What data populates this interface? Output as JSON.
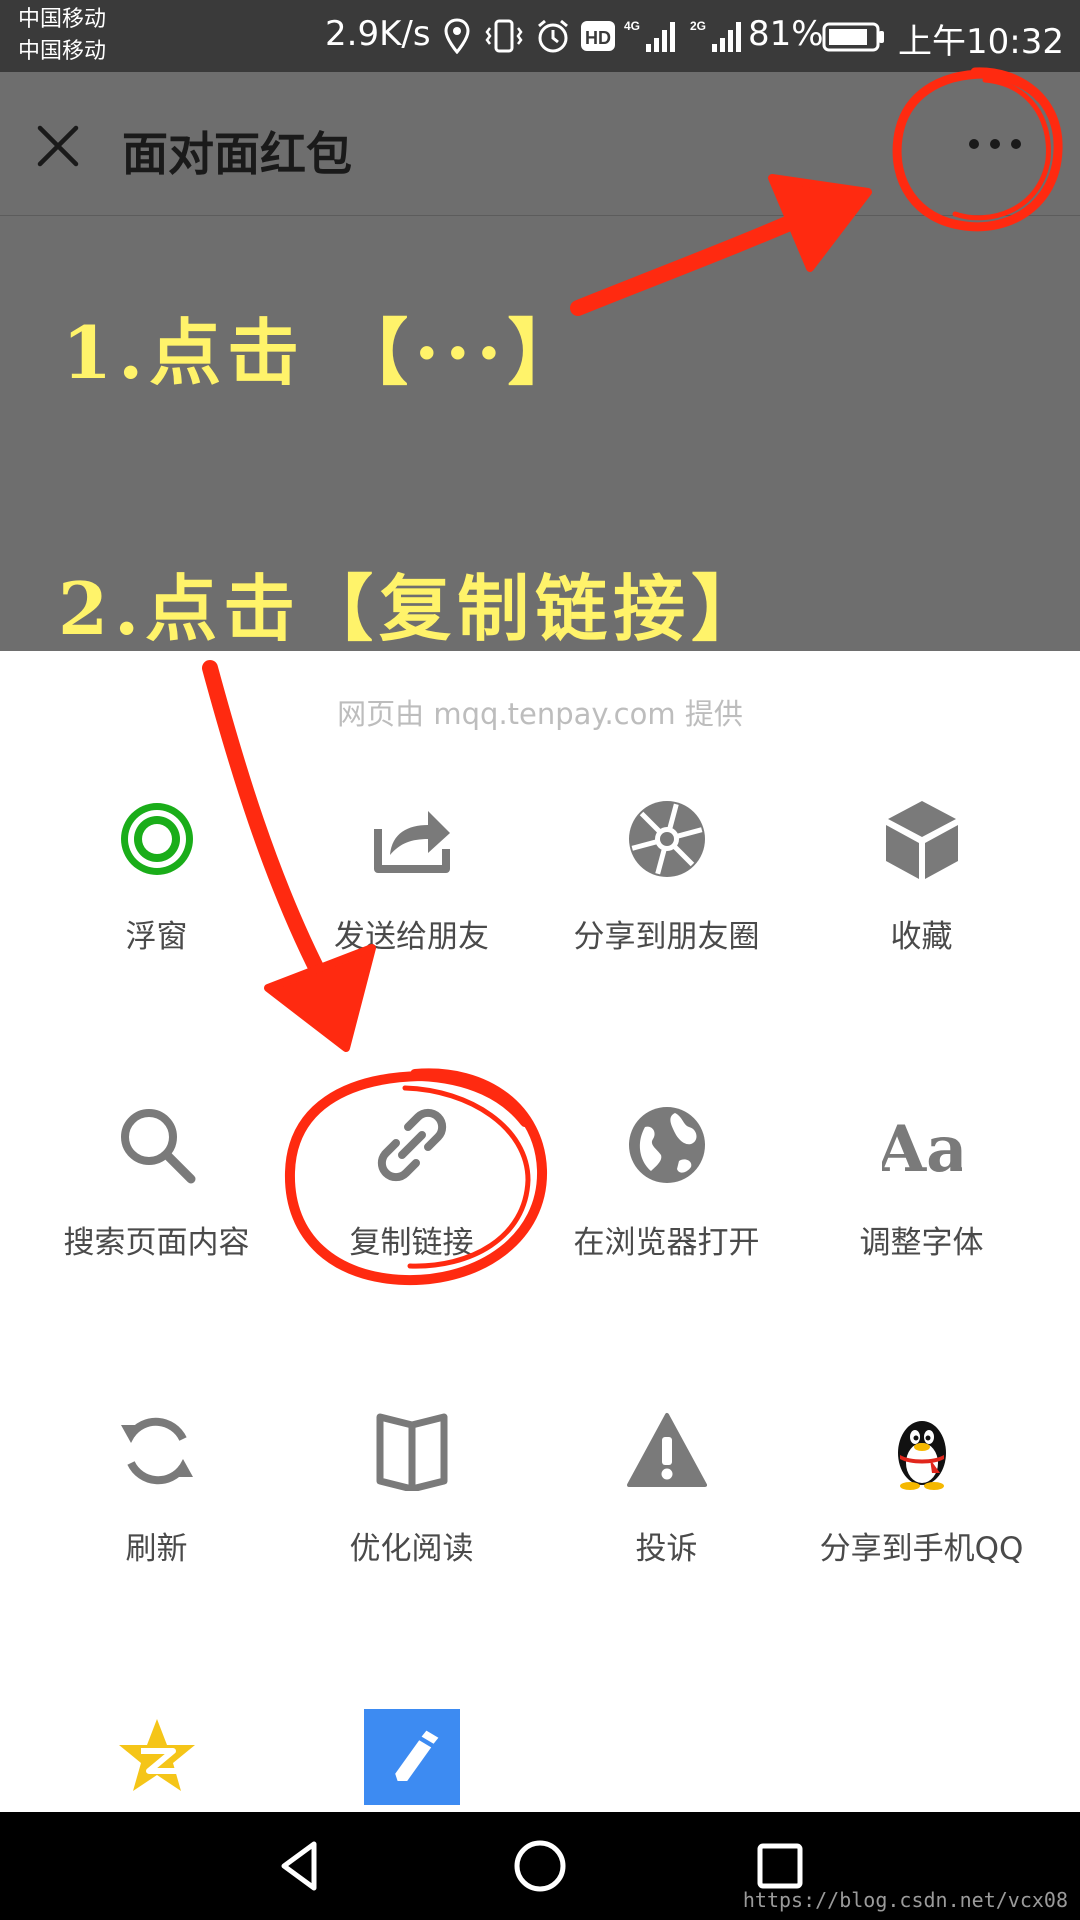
{
  "status_bar": {
    "carrier_1": "中国移动",
    "carrier_2": "中国移动",
    "net_speed": "2.9K/s",
    "signal_label_1": "4G",
    "signal_label_2": "2G",
    "hd_label": "HD",
    "battery_percent": "81%",
    "time": "上午10:32",
    "icons": [
      "location-icon",
      "vibrate-icon",
      "alarm-icon",
      "hd-icon",
      "signal-4g-icon",
      "signal-2g-icon",
      "battery-icon"
    ]
  },
  "header": {
    "close_icon": "close-icon",
    "title": "面对面红包",
    "more_icon": "more-icon"
  },
  "annotations": {
    "step1": "1.点击 【···】",
    "step2": "2.点击【复制链接】",
    "color": "#ff2a10"
  },
  "sheet": {
    "provider_text": "网页由 mqq.tenpay.com 提供",
    "items": [
      {
        "label": "浮窗",
        "icon": "floating-window-icon"
      },
      {
        "label": "发送给朋友",
        "icon": "share-forward-icon"
      },
      {
        "label": "分享到朋友圈",
        "icon": "moments-icon"
      },
      {
        "label": "收藏",
        "icon": "favorite-cube-icon"
      },
      {
        "label": "搜索页面内容",
        "icon": "search-icon"
      },
      {
        "label": "复制链接",
        "icon": "link-icon"
      },
      {
        "label": "在浏览器打开",
        "icon": "globe-icon"
      },
      {
        "label": "调整字体",
        "icon": "font-size-icon",
        "glyph": "Aa"
      },
      {
        "label": "刷新",
        "icon": "refresh-icon"
      },
      {
        "label": "优化阅读",
        "icon": "book-icon"
      },
      {
        "label": "投诉",
        "icon": "warning-icon"
      },
      {
        "label": "分享到手机QQ",
        "icon": "qq-penguin-icon"
      },
      {
        "label": "",
        "icon": "qzone-star-icon"
      },
      {
        "label": "",
        "icon": "edit-note-icon"
      }
    ]
  },
  "nav_bar": {
    "icons": [
      "back-triangle-icon",
      "home-circle-icon",
      "recents-square-icon"
    ],
    "watermark": "https://blog.csdn.net/vcx08"
  },
  "colors": {
    "status_bg": "#3a3a3a",
    "dim_bg": "#6e6e6e",
    "step_text": "#fff36a",
    "icon_gray": "#7a7a7a",
    "green": "#1aad19",
    "qzone_yellow": "#f5c518",
    "note_blue": "#3d8bf2"
  }
}
